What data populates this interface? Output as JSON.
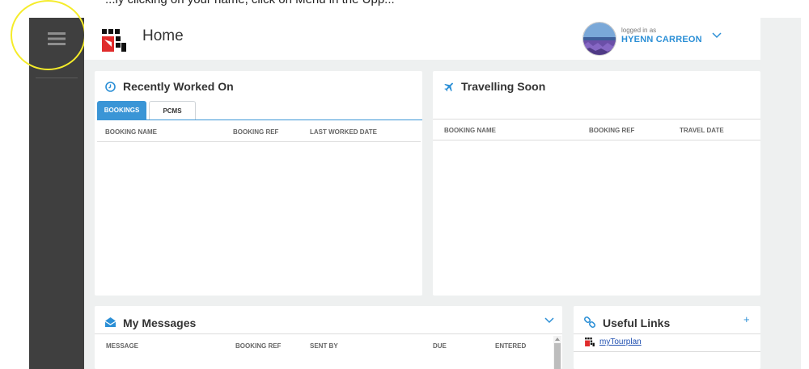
{
  "top_strip": {
    "text": "...ly clicking on your name, click on Menu in the Upp..."
  },
  "header": {
    "title": "Home",
    "login_label": "logged in as",
    "username": "HYENN CARREON"
  },
  "recently_worked_on": {
    "title": "Recently Worked On",
    "tabs": [
      {
        "label": "BOOKINGS"
      },
      {
        "label": "PCMS"
      }
    ],
    "columns": [
      "BOOKING NAME",
      "BOOKING REF",
      "LAST WORKED DATE"
    ]
  },
  "travelling_soon": {
    "title": "Travelling Soon",
    "columns": [
      "BOOKING NAME",
      "BOOKING REF",
      "TRAVEL DATE"
    ]
  },
  "my_messages": {
    "title": "My Messages",
    "columns": [
      "MESSAGE",
      "BOOKING REF",
      "SENT BY",
      "DUE",
      "ENTERED"
    ]
  },
  "useful_links": {
    "title": "Useful Links",
    "add_label": "+",
    "links": [
      {
        "label": "myTourplan"
      }
    ]
  },
  "colors": {
    "accent": "#2b8fd6",
    "tab_active": "#3a95d6",
    "sidebar": "#3f3f3f",
    "background": "#eef0f0",
    "highlight": "#f5ec2a",
    "logo_red": "#e02b2b"
  },
  "icons": {
    "menu": "hamburger-icon",
    "recent": "clock-icon",
    "travel": "airplane-icon",
    "messages": "envelope-icon",
    "links": "link-icon",
    "dropdown": "chevron-down-icon"
  }
}
